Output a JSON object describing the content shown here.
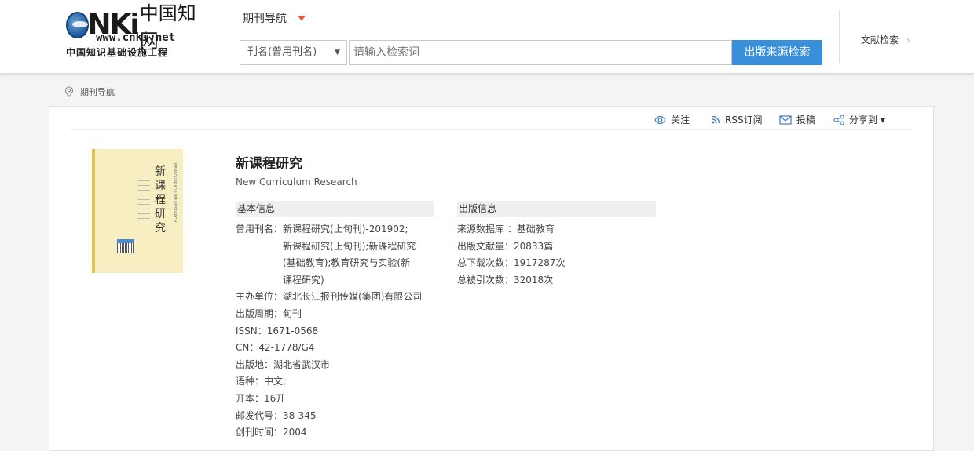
{
  "header": {
    "logo": {
      "brand": "NKi",
      "brand_cn": "中国知网",
      "url": "www.cnki.net",
      "subtitle": "中国知识基础设施工程"
    },
    "nav_title": "期刊导航",
    "search": {
      "field_selected": "刊名(曾用刊名)",
      "placeholder": "请输入检索词",
      "button_label": "出版来源检索"
    },
    "doc_search_label": "文献检索",
    "doc_search_chevron": "›"
  },
  "breadcrumb": {
    "label": "期刊导航"
  },
  "toolbar": {
    "follow": "关注",
    "rss": "RSS订阅",
    "submit": "投稿",
    "share": "分享到 ▾"
  },
  "journal": {
    "title": "新课程研究",
    "title_en": "New Curriculum Research",
    "cover_title": "新课程研究",
    "cover_en": "NEW CURRICULUM RESEARCH"
  },
  "basic_info": {
    "heading": "基本信息",
    "fields": [
      {
        "key": "曾用刊名：",
        "value": "新课程研究(上旬刊)-201902;新课程研究(上旬刊);新课程研究(基础教育);教育研究与实验(新课程研究)"
      },
      {
        "key": "主办单位：",
        "value": "湖北长江报刊传媒(集团)有限公司"
      },
      {
        "key": "出版周期：",
        "value": "旬刊"
      },
      {
        "key": "ISSN：",
        "value": "1671-0568"
      },
      {
        "key": "CN：",
        "value": "42-1778/G4"
      },
      {
        "key": "出版地：",
        "value": "湖北省武汉市"
      },
      {
        "key": "语种：",
        "value": "中文;"
      },
      {
        "key": "开本：",
        "value": "16开"
      },
      {
        "key": "邮发代号：",
        "value": "38-345"
      },
      {
        "key": "创刊时间：",
        "value": "2004"
      }
    ]
  },
  "pub_info": {
    "heading": "出版信息",
    "fields": [
      {
        "key": "来源数据库 ：",
        "value": "基础教育"
      },
      {
        "key": "出版文献量：",
        "value": "20833篇"
      },
      {
        "key": "总下载次数：",
        "value": "1917287次"
      },
      {
        "key": "总被引次数：",
        "value": "32018次"
      }
    ]
  }
}
